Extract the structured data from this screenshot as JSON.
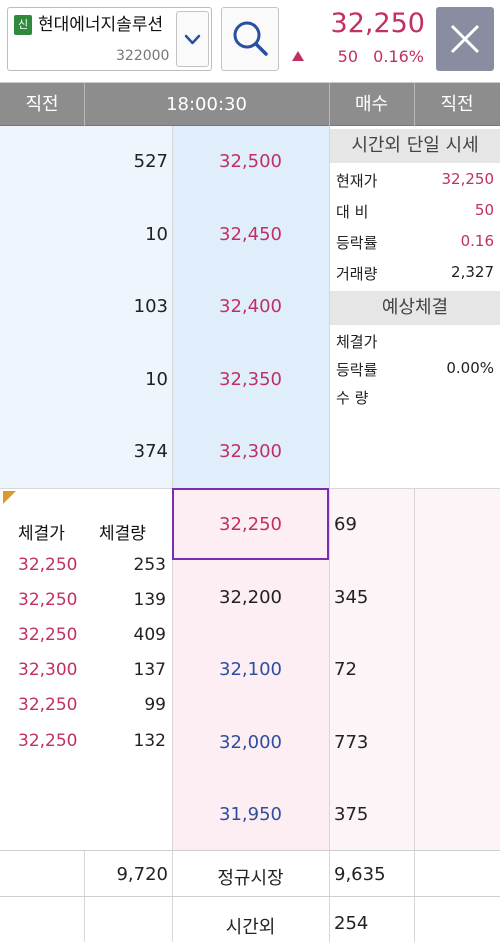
{
  "top": {
    "badge": "신",
    "stock_name": "현대에너지솔루션",
    "stock_code": "322000",
    "price": "32,250",
    "change": "50",
    "change_rate": "0.16%"
  },
  "header": {
    "col1": "직전",
    "time": "18:00:30",
    "col3": "매수",
    "col4": "직전"
  },
  "asks": [
    {
      "qty": "527",
      "price": "32,500"
    },
    {
      "qty": "10",
      "price": "32,450"
    },
    {
      "qty": "103",
      "price": "32,400"
    },
    {
      "qty": "10",
      "price": "32,350"
    },
    {
      "qty": "374",
      "price": "32,300"
    }
  ],
  "bids": [
    {
      "price": "32,250",
      "qty": "69"
    },
    {
      "price": "32,200",
      "qty": "345"
    },
    {
      "price": "32,100",
      "qty": "72"
    },
    {
      "price": "32,000",
      "qty": "773"
    },
    {
      "price": "31,950",
      "qty": "375"
    }
  ],
  "info": {
    "title1": "시간외 단일 시세",
    "rows1": [
      {
        "label": "현재가",
        "value": "32,250"
      },
      {
        "label": "대  비",
        "value": "50"
      },
      {
        "label": "등락률",
        "value": "0.16"
      },
      {
        "label": "거래량",
        "value": "2,327"
      }
    ],
    "title2": "예상체결",
    "rows2": [
      {
        "label": "체결가",
        "value": ""
      },
      {
        "label": "등락률",
        "value": "0.00%"
      },
      {
        "label": "수  량",
        "value": ""
      }
    ]
  },
  "trades": {
    "head_price": "체결가",
    "head_qty": "체결량",
    "rows": [
      {
        "price": "32,250",
        "qty": "253"
      },
      {
        "price": "32,250",
        "qty": "139"
      },
      {
        "price": "32,250",
        "qty": "409"
      },
      {
        "price": "32,300",
        "qty": "137"
      },
      {
        "price": "32,250",
        "qty": "99"
      },
      {
        "price": "32,250",
        "qty": "132"
      }
    ]
  },
  "footer": {
    "ask_total": "9,720",
    "regular_label": "정규시장",
    "bid_total": "9,635",
    "afterhours_label": "시간외",
    "afterhours_value": "254"
  },
  "colors": {
    "up": "#c03065",
    "down": "#2c4f9e",
    "header_bg": "#8d8d8d"
  }
}
